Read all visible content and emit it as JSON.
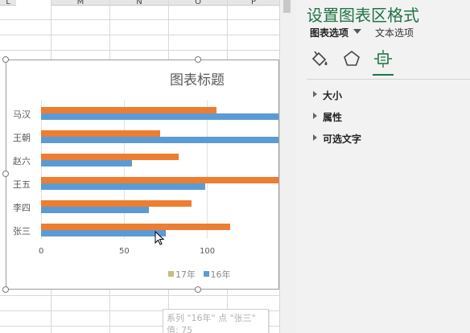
{
  "sheet": {
    "column_headers": [
      "L",
      "M",
      "N",
      "O",
      "P"
    ]
  },
  "chart": {
    "title": "图表标题",
    "tooltip": {
      "line1": "系列 \"16年\" 点 \"张三\"",
      "line2": "值: 75"
    },
    "legend": [
      "17年",
      "16年"
    ]
  },
  "chart_data": {
    "type": "bar",
    "title": "图表标题",
    "categories": [
      "张三",
      "李四",
      "王五",
      "赵六",
      "王朝",
      "马汉"
    ],
    "series": [
      {
        "name": "17年",
        "values": [
          114,
          91,
          150,
          83,
          72,
          106
        ],
        "color": "#ed7d31"
      },
      {
        "name": "16年",
        "values": [
          75,
          65,
          99,
          55,
          150,
          150
        ],
        "color": "#5b9bd5"
      }
    ],
    "x_ticks": [
      "0",
      "50",
      "100"
    ],
    "xlim": [
      0,
      150
    ],
    "grid": true,
    "legend_placement": "bottom"
  },
  "pane": {
    "title": "设置图表区格式",
    "tabs": [
      {
        "label": "图表选项"
      },
      {
        "label": "文本选项"
      }
    ],
    "sections": [
      {
        "label": "大小"
      },
      {
        "label": "属性"
      },
      {
        "label": "可选文字"
      }
    ],
    "accent_color": "#217346"
  }
}
